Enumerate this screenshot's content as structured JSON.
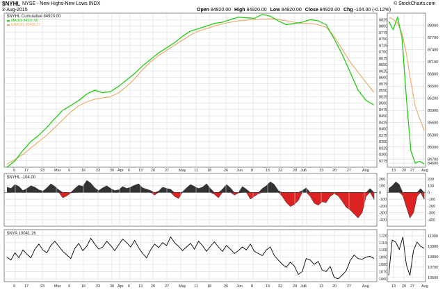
{
  "header": {
    "symbol": "$NYHL",
    "description": "NYSE - New Highs-New Lows INDX",
    "date": "3-Aug-2015",
    "brand": "© StockCharts.com",
    "ohlc": [
      {
        "label": "Open",
        "value": "84920.00"
      },
      {
        "label": "High",
        "value": "84920.00"
      },
      {
        "label": "Low",
        "value": "84920.00"
      },
      {
        "label": "Close",
        "value": "84920.00"
      },
      {
        "label": "Chg",
        "value": "-104.00 (-0.12%)"
      }
    ]
  },
  "legends": {
    "main_title": "$NYHL Cumulative 84920.00",
    "sma": "MA(10) 84920.00",
    "ema": "EMA(30) 85408.27",
    "hist": "$NYHL -104.00",
    "nya": "$NYA 10041.26"
  },
  "colors": {
    "sma": "#22cc11",
    "ema": "#e8a868",
    "hist_pos": "#333333",
    "hist_neg": "#dd2222",
    "grid": "#d8d8d8",
    "panel_border": "#666666"
  },
  "chart_data": [
    {
      "type": "line",
      "panel": "cumulative",
      "xlabels": [
        "9",
        "17",
        "23",
        "Mar",
        "9",
        "16",
        "23",
        "30",
        "Apr",
        "6",
        "13",
        "20",
        "27",
        "May",
        "11",
        "18",
        "26",
        "Jun",
        "8",
        "15",
        "22",
        "29",
        "Jul",
        "6",
        "13",
        "20",
        "27",
        "Aug"
      ],
      "ylabels": [
        "88250",
        "88000",
        "87750",
        "87500",
        "87250",
        "87000",
        "86750",
        "86500",
        "86250",
        "86000",
        "85750",
        "85500",
        "85250",
        "85000",
        "84750",
        "84500",
        "84250",
        "84000",
        "83750",
        "83500",
        "83250",
        "83000",
        "82750"
      ],
      "ylim": [
        82500,
        88500
      ],
      "series": [
        {
          "name": "MA(10) 84920.00",
          "color": "#22cc11",
          "values": [
            82500,
            82750,
            83150,
            83500,
            83750,
            84050,
            84400,
            84720,
            84900,
            85100,
            85350,
            85500,
            85400,
            85450,
            85650,
            85900,
            86150,
            86450,
            86700,
            86950,
            87150,
            87350,
            87600,
            87800,
            87900,
            88000,
            88100,
            88150,
            88250,
            88350,
            88320,
            88300,
            88450,
            88380,
            88200,
            88050,
            88100,
            88150,
            88250,
            88200,
            88050,
            87500,
            86900,
            86200,
            85500,
            85100,
            84920
          ]
        },
        {
          "name": "EMA(30) 85408.27",
          "color": "#e8a868",
          "values": [
            82620,
            82800,
            83000,
            83250,
            83500,
            83750,
            84050,
            84350,
            84650,
            84900,
            85050,
            85150,
            85200,
            85250,
            85400,
            85650,
            85950,
            86300,
            86600,
            86850,
            87050,
            87250,
            87450,
            87650,
            87800,
            87900,
            88000,
            88080,
            88150,
            88200,
            88230,
            88250,
            88270,
            88280,
            88250,
            88200,
            88150,
            88100,
            88100,
            88050,
            87950,
            87600,
            87100,
            86600,
            86200,
            85800,
            85408
          ]
        }
      ]
    },
    {
      "type": "line",
      "panel": "cumulative-zoom",
      "xlabels": [
        "13",
        "20",
        "27",
        "Aug"
      ],
      "ylabels": [
        "88000",
        "87700",
        "87400",
        "87100",
        "86800",
        "86500",
        "86200",
        "85900",
        "85600",
        "85300",
        "85000",
        "84700",
        "84600"
      ],
      "ylim": [
        84500,
        88300
      ],
      "series": [
        {
          "name": "MA(10) 84920.00",
          "color": "#22cc11",
          "values": [
            88100,
            87900,
            88200,
            87700,
            86200,
            84900,
            84600,
            84650,
            84580
          ]
        },
        {
          "name": "EMA(30) 85408.27",
          "color": "#e8a868",
          "values": [
            88200,
            88150,
            88050,
            87800,
            87300,
            86600,
            86000,
            85700,
            85408
          ]
        }
      ]
    },
    {
      "type": "area",
      "panel": "histogram",
      "ylabels": [
        "200",
        "100",
        "0",
        "-100",
        "-200",
        "-300",
        "-400"
      ],
      "ylim": [
        -500,
        280
      ],
      "values": [
        80,
        60,
        120,
        90,
        30,
        60,
        100,
        80,
        40,
        20,
        70,
        130,
        90,
        40,
        -80,
        -50,
        -10,
        60,
        110,
        90,
        180,
        140,
        70,
        30,
        70,
        100,
        60,
        30,
        40,
        90,
        60,
        80,
        110,
        130,
        70,
        50,
        30,
        -40,
        20,
        80,
        60,
        50,
        -60,
        -90,
        10,
        70,
        120,
        90,
        60,
        80,
        130,
        60,
        -30,
        -80,
        50,
        120,
        70,
        -40,
        -10,
        90,
        50,
        -100,
        -60,
        -20,
        60,
        100,
        160,
        120,
        30,
        -60,
        -150,
        -210,
        -180,
        -120,
        30,
        70,
        -60,
        -160,
        -190,
        -140,
        -150,
        -60,
        -20,
        -50,
        -130,
        -220,
        -260,
        -320,
        -380,
        -300,
        -60,
        60,
        -104
      ]
    },
    {
      "type": "area",
      "panel": "histogram-zoom",
      "ylabels": [
        "200",
        "100",
        "0",
        "-100",
        "-200",
        "-300",
        "-400"
      ],
      "ylim": [
        -500,
        280
      ],
      "values": [
        60,
        100,
        160,
        120,
        -50,
        -220,
        -380,
        -300,
        -60,
        60,
        -104
      ]
    },
    {
      "type": "line",
      "panel": "nya",
      "ylabels": [
        "11200",
        "11100",
        "11000",
        "10900",
        "10800",
        "10700",
        "10600"
      ],
      "ylim": [
        10560,
        11280
      ],
      "values": [
        10900,
        10860,
        10960,
        10890,
        11000,
        10940,
        10890,
        11010,
        11080,
        11000,
        10960,
        11060,
        11120,
        11050,
        10980,
        10930,
        10880,
        11020,
        11090,
        10990,
        11050,
        11160,
        11080,
        11010,
        11040,
        11120,
        11060,
        10990,
        11070,
        11150,
        11100,
        11040,
        11130,
        11030,
        10950,
        10890,
        11000,
        11080,
        11030,
        11100,
        11060,
        11180,
        11100,
        11050,
        10990,
        11040,
        11090,
        11010,
        11120,
        11060,
        10980,
        11050,
        11110,
        11040,
        10980,
        11060,
        11010,
        10950,
        10990,
        11040,
        11000,
        11080,
        10980,
        10950,
        10920,
        11000,
        11040,
        10920,
        10860,
        10800,
        10760,
        10830,
        10780,
        10660,
        10700,
        10880,
        10860,
        10800,
        10840,
        10720,
        10700,
        10770,
        10620,
        10600,
        10650,
        10710,
        10850,
        10930,
        10880,
        10870,
        10900,
        10910,
        10880
      ]
    },
    {
      "type": "line",
      "panel": "nya-zoom",
      "ylabels": [
        "11000",
        "10900",
        "10800",
        "10700",
        "10600"
      ],
      "ylim": [
        10560,
        11060
      ],
      "values": [
        10620,
        10960,
        10940,
        10870,
        10990,
        10720,
        10620,
        10860,
        10940,
        10900,
        10880
      ]
    }
  ]
}
